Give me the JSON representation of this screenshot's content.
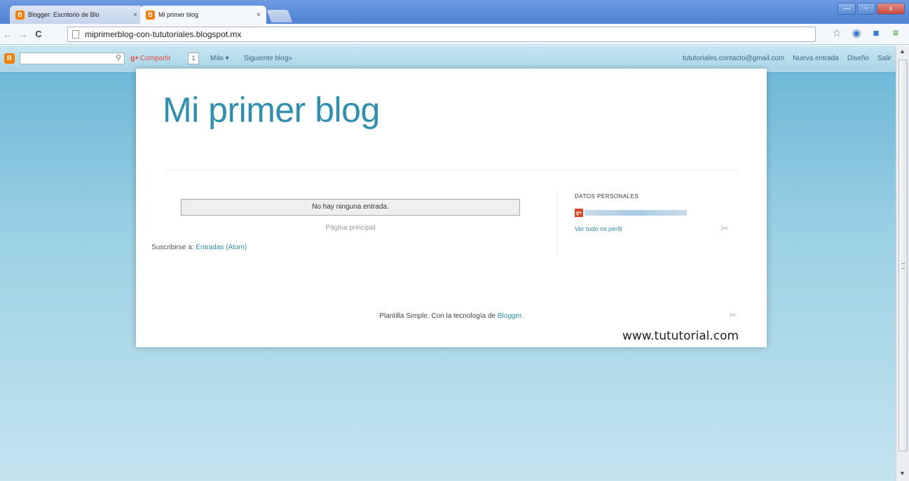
{
  "browser": {
    "tabs": [
      {
        "label": "Blogger: Escritorio de Blo",
        "favicon": "blogger-favicon",
        "active": false
      },
      {
        "label": "Mi primer blog",
        "favicon": "blogger-favicon",
        "active": true
      }
    ],
    "close_glyph": "×",
    "url": "miprimerblog-con-tututoriales.blogspot.mx",
    "window_buttons": {
      "minimize": "—",
      "maximize": "▫",
      "close": "x"
    }
  },
  "blogger_navbar": {
    "logo_letter": "B",
    "share_label": "Compartir",
    "share_count": "1",
    "more_label": "Más ▾",
    "next_blog_label": "Siguiente blog»",
    "user_email": "tututoriales.contacto@gmail.com",
    "new_post_label": "Nueva entrada",
    "design_label": "Diseño",
    "logout_label": "Salir"
  },
  "blog": {
    "title": "Mi primer blog",
    "no_posts_text": "No hay ninguna entrada.",
    "home_link": "Página principal",
    "subscribe_prefix": "Suscribirse a:",
    "subscribe_link": "Entradas (Atom)",
    "sidebar": {
      "widget_title": "DATOS PERSONALES",
      "avatar_glyph": "g+",
      "profile_link": "Ver todo mi perfil"
    },
    "footer": {
      "text": "Plantilla Simple. Con la tecnología de",
      "link": "Blogger."
    },
    "watermark": "www.tututorial.com"
  },
  "colors": {
    "accent": "#2e8fb0",
    "blogger_orange": "#f57d00",
    "titlebar": "#4f82d4"
  }
}
